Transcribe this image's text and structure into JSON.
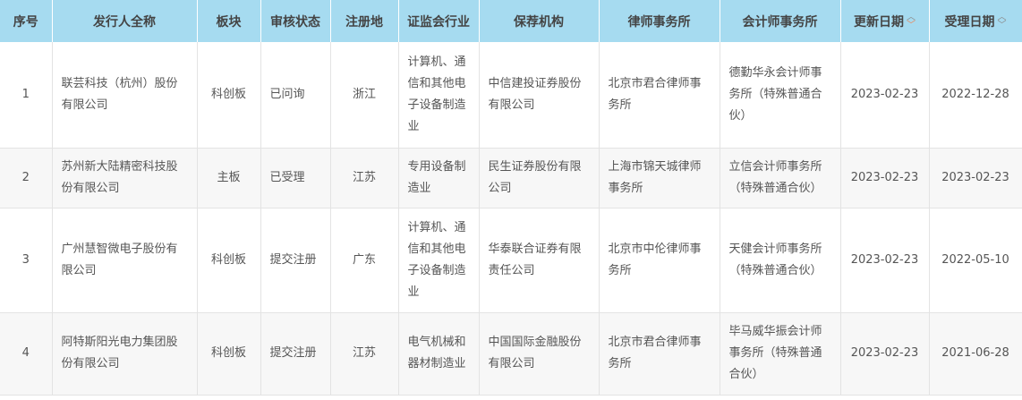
{
  "table": {
    "headers": {
      "index": "序号",
      "issuer": "发行人全称",
      "board": "板块",
      "status": "审核状态",
      "region": "注册地",
      "industry": "证监会行业",
      "sponsor": "保荐机构",
      "law_firm": "律师事务所",
      "accounting_firm": "会计师事务所",
      "update_date": "更新日期",
      "accept_date": "受理日期"
    },
    "sort_icons": {
      "up": "chevron-up-icon",
      "down": "chevron-down-icon"
    },
    "rows": [
      {
        "index": "1",
        "issuer": "联芸科技（杭州）股份有限公司",
        "board": "科创板",
        "status": "已问询",
        "region": "浙江",
        "industry": "计算机、通信和其他电子设备制造业",
        "sponsor": "中信建投证券股份有限公司",
        "law_firm": "北京市君合律师事务所",
        "accounting_firm": "德勤华永会计师事务所（特殊普通合伙）",
        "update_date": "2023-02-23",
        "accept_date": "2022-12-28"
      },
      {
        "index": "2",
        "issuer": "苏州新大陆精密科技股份有限公司",
        "board": "主板",
        "status": "已受理",
        "region": "江苏",
        "industry": "专用设备制造业",
        "sponsor": "民生证券股份有限公司",
        "law_firm": "上海市锦天城律师事务所",
        "accounting_firm": "立信会计师事务所（特殊普通合伙）",
        "update_date": "2023-02-23",
        "accept_date": "2023-02-23"
      },
      {
        "index": "3",
        "issuer": "广州慧智微电子股份有限公司",
        "board": "科创板",
        "status": "提交注册",
        "region": "广东",
        "industry": "计算机、通信和其他电子设备制造业",
        "sponsor": "华泰联合证券有限责任公司",
        "law_firm": "北京市中伦律师事务所",
        "accounting_firm": "天健会计师事务所（特殊普通合伙）",
        "update_date": "2023-02-23",
        "accept_date": "2022-05-10"
      },
      {
        "index": "4",
        "issuer": "阿特斯阳光电力集团股份有限公司",
        "board": "科创板",
        "status": "提交注册",
        "region": "江苏",
        "industry": "电气机械和器材制造业",
        "sponsor": "中国国际金融股份有限公司",
        "law_firm": "北京市君合律师事务所",
        "accounting_firm": "毕马威华振会计师事务所（特殊普通合伙）",
        "update_date": "2023-02-23",
        "accept_date": "2021-06-28"
      }
    ]
  }
}
